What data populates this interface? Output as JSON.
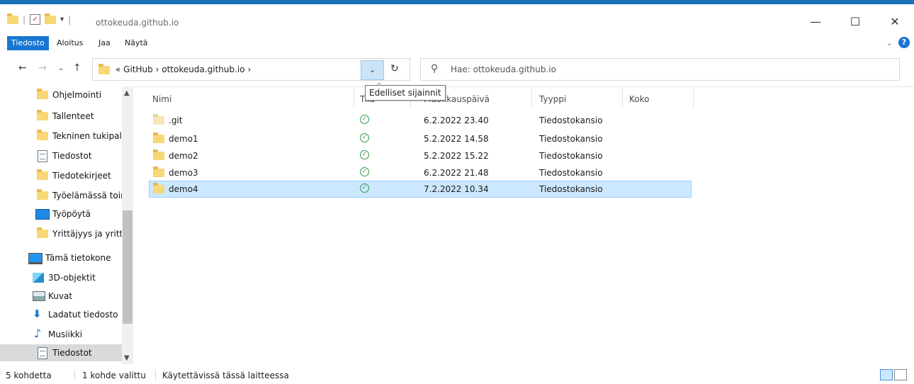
{
  "window": {
    "title": "ottokeuda.github.io"
  },
  "ribbon": {
    "tabs": [
      "Tiedosto",
      "Aloitus",
      "Jaa",
      "Näytä"
    ],
    "help": "?"
  },
  "address": {
    "overflow": "«",
    "crumbs": [
      "GitHub",
      "ottokeuda.github.io"
    ],
    "separator": "›"
  },
  "search": {
    "placeholder": "Hae: ottokeuda.github.io"
  },
  "tooltip": "Edelliset sijainnit",
  "nav": {
    "items": [
      {
        "label": "Ohjelmointi",
        "icon": "folder-icon"
      },
      {
        "label": "Tallenteet",
        "icon": "folder-icon"
      },
      {
        "label": "Tekninen tukipal",
        "icon": "folder-icon"
      },
      {
        "label": "Tiedostot",
        "icon": "document-icon"
      },
      {
        "label": "Tiedotekirjeet",
        "icon": "folder-icon"
      },
      {
        "label": "Työelämässä toir",
        "icon": "folder-icon"
      },
      {
        "label": "Työpöytä",
        "icon": "desktop-icon"
      },
      {
        "label": "Yrittäjyys ja yrittä",
        "icon": "folder-icon"
      },
      {
        "label": "Tämä tietokone",
        "icon": "computer-icon"
      },
      {
        "label": "3D-objektit",
        "icon": "cube-icon"
      },
      {
        "label": "Kuvat",
        "icon": "pictures-icon"
      },
      {
        "label": "Ladatut tiedosto",
        "icon": "download-icon"
      },
      {
        "label": "Musiikki",
        "icon": "music-icon"
      },
      {
        "label": "Tiedostot",
        "icon": "document-icon"
      }
    ]
  },
  "columns": {
    "name": "Nimi",
    "status": "Tila",
    "modified": "Muokkauspäivä",
    "type": "Tyyppi",
    "size": "Koko"
  },
  "files": [
    {
      "name": ".git",
      "modified": "6.2.2022 23.40",
      "type": "Tiedostokansio",
      "icon": "folder-light-icon",
      "status": "synced-icon"
    },
    {
      "name": "demo1",
      "modified": "5.2.2022 14.58",
      "type": "Tiedostokansio",
      "icon": "folder-icon",
      "status": "synced-icon"
    },
    {
      "name": "demo2",
      "modified": "5.2.2022 15.22",
      "type": "Tiedostokansio",
      "icon": "folder-icon",
      "status": "synced-icon"
    },
    {
      "name": "demo3",
      "modified": "6.2.2022 21.48",
      "type": "Tiedostokansio",
      "icon": "folder-icon",
      "status": "synced-icon"
    },
    {
      "name": "demo4",
      "modified": "7.2.2022 10.34",
      "type": "Tiedostokansio",
      "icon": "folder-icon",
      "status": "synced-icon"
    }
  ],
  "selected_index": 4,
  "statusbar": {
    "count": "5 kohdetta",
    "selected": "1 kohde valittu",
    "availability": "Käytettävissä tässä laitteessa"
  },
  "colors": {
    "accent": "#1a6fb5",
    "selection": "#cce8ff",
    "file_tab": "#1976d2",
    "synced": "#2e9b45"
  }
}
